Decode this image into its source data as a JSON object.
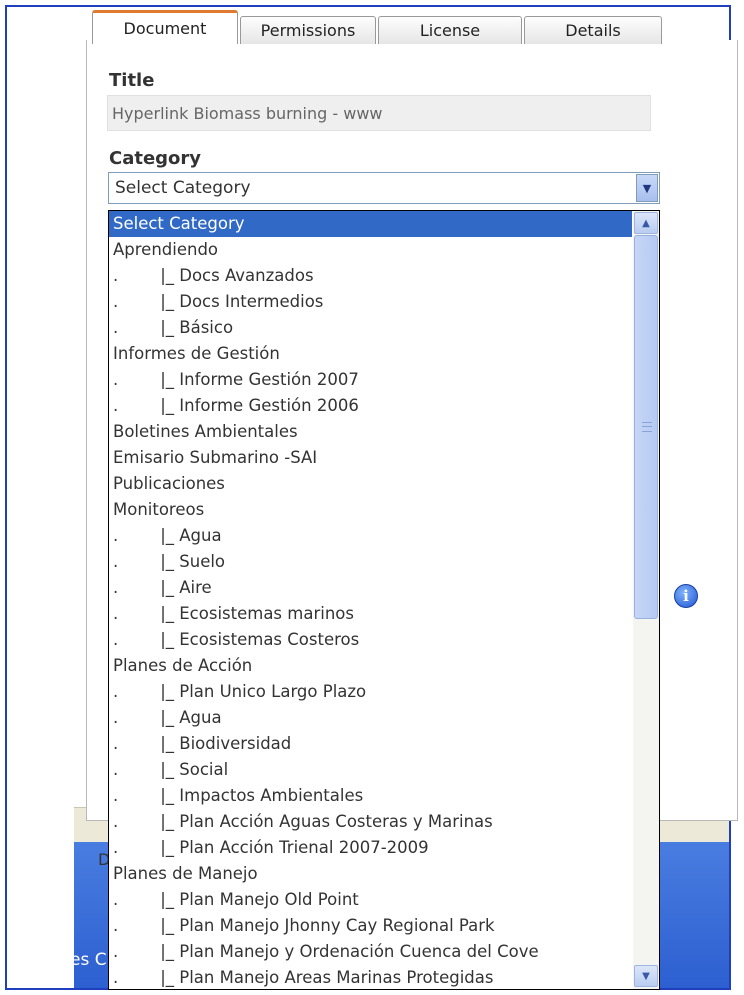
{
  "tabs": [
    {
      "label": "Document",
      "active": true
    },
    {
      "label": "Permissions",
      "active": false
    },
    {
      "label": "License",
      "active": false
    },
    {
      "label": "Details",
      "active": false
    }
  ],
  "form": {
    "title_label": "Title",
    "title_value": "Hyperlink Biomass burning - www",
    "category_label": "Category",
    "category_selected": "Select Category"
  },
  "category_options": [
    "Select Category",
    "Aprendiendo",
    ".        |_ Docs Avanzados",
    ".        |_ Docs Intermedios",
    ".        |_ Básico",
    "Informes de Gestión",
    ".        |_ Informe Gestión 2007",
    ".        |_ Informe Gestión 2006",
    "Boletines Ambientales",
    "Emisario Submarino -SAI",
    "Publicaciones",
    "Monitoreos",
    ".        |_ Agua",
    ".        |_ Suelo",
    ".        |_ Aire",
    ".        |_ Ecosistemas marinos",
    ".        |_ Ecosistemas Costeros",
    "Planes de Acción",
    ".        |_ Plan Unico Largo Plazo",
    ".        |_ Agua",
    ".        |_ Biodiversidad",
    ".        |_ Social",
    ".        |_ Impactos Ambientales",
    ".        |_ Plan Acción Aguas Costeras y Marinas",
    ".        |_ Plan Acción Trienal 2007-2009",
    "Planes de Manejo",
    ".        |_ Plan Manejo Old Point",
    ".        |_ Plan Manejo Jhonny Cay Regional Park",
    ".        |_ Plan Manejo y Ordenación Cuenca del Cove",
    ".        |_ Plan Manejo Areas Marinas Protegidas"
  ],
  "background": {
    "grey_strip_text": "D",
    "blue_strip_text": "es C"
  },
  "icons": {
    "dropdown_arrow": "chevron-down-icon",
    "scroll_up": "chevron-up-icon",
    "scroll_down": "chevron-down-icon",
    "info": "info-icon"
  },
  "colors": {
    "frame_border": "#1f3fbf",
    "active_tab_accent": "#e07a2f",
    "selection": "#3169c6",
    "taskbar_blue": "#2c5fd0"
  }
}
